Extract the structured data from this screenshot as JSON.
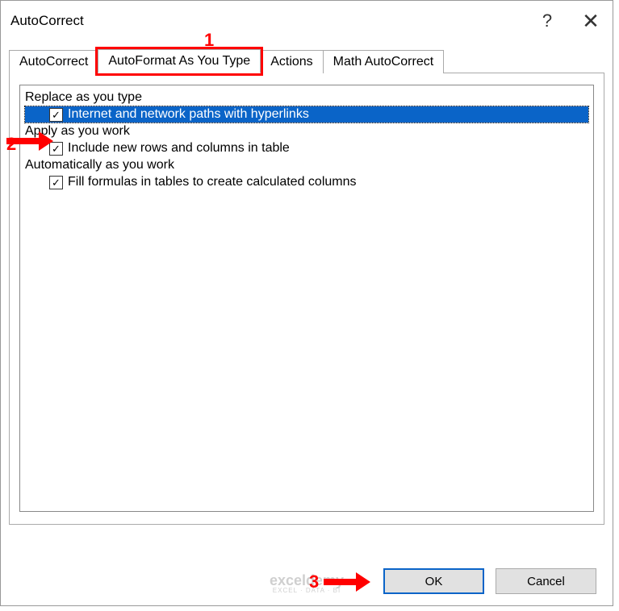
{
  "dialog": {
    "title": "AutoCorrect",
    "help_tooltip": "?",
    "close_tooltip": "✕"
  },
  "tabs": {
    "autocorrect": "AutoCorrect",
    "autoformat": "AutoFormat As You Type",
    "actions": "Actions",
    "math": "Math AutoCorrect"
  },
  "sections": {
    "replace": "Replace as you type",
    "apply": "Apply as you work",
    "auto": "Automatically as you work"
  },
  "options": {
    "internet_paths": "Internet and network paths with hyperlinks",
    "include_rows": "Include new rows and columns in table",
    "fill_formulas": "Fill formulas in tables to create calculated columns"
  },
  "buttons": {
    "ok": "OK",
    "cancel": "Cancel"
  },
  "annotations": {
    "n1": "1",
    "n2": "2",
    "n3": "3"
  },
  "watermark": {
    "brand": "exceldemy",
    "sub": "EXCEL · DATA · BI"
  }
}
